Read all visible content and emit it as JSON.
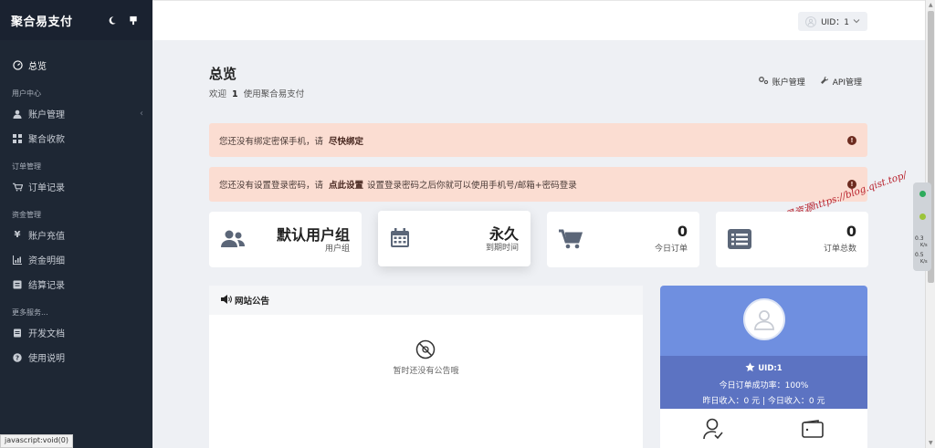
{
  "sidebar": {
    "brand": "聚合易支付",
    "items": [
      {
        "type": "item",
        "label": "总览",
        "icon": "dashboard-icon",
        "active": true
      },
      {
        "type": "header",
        "label": "用户中心"
      },
      {
        "type": "item",
        "label": "账户管理",
        "icon": "user-icon",
        "chevron": true
      },
      {
        "type": "item",
        "label": "聚合收款",
        "icon": "grid-icon"
      },
      {
        "type": "header",
        "label": "订单管理"
      },
      {
        "type": "item",
        "label": "订单记录",
        "icon": "cart-icon"
      },
      {
        "type": "header",
        "label": "资金管理"
      },
      {
        "type": "item",
        "label": "账户充值",
        "icon": "yen-icon"
      },
      {
        "type": "item",
        "label": "资金明细",
        "icon": "chart-icon"
      },
      {
        "type": "item",
        "label": "结算记录",
        "icon": "settle-icon"
      },
      {
        "type": "header",
        "label": "更多服务..."
      },
      {
        "type": "item",
        "label": "开发文档",
        "icon": "doc-icon"
      },
      {
        "type": "item",
        "label": "使用说明",
        "icon": "help-icon"
      }
    ]
  },
  "statusbar": "javascript:void(0)",
  "topbar": {
    "uid_label": "UID：1"
  },
  "page": {
    "title": "总览",
    "welcome_prefix": "欢迎",
    "welcome_uid": "1",
    "welcome_suffix": "使用聚合易支付",
    "account_manage": "账户管理",
    "api_manage": "API管理"
  },
  "alerts": [
    {
      "text": "您还没有绑定密保手机，请",
      "link": "尽快绑定",
      "more": ""
    },
    {
      "text": "您还没有设置登录密码，请",
      "link": "点此设置",
      "more": "设置登录密码之后你就可以使用手机号/邮箱+密码登录"
    }
  ],
  "watermark": "泰星资源https://blog.qist.top/",
  "stats": [
    {
      "value": "默认用户组",
      "label": "用户组",
      "icon": "users-icon"
    },
    {
      "value": "永久",
      "label": "到期时间",
      "icon": "calendar-icon"
    },
    {
      "value": "0",
      "label": "今日订单",
      "icon": "cart-icon"
    },
    {
      "value": "0",
      "label": "订单总数",
      "icon": "list-icon"
    }
  ],
  "notice": {
    "title": "网站公告",
    "empty": "暂时还没有公告哦"
  },
  "profile": {
    "uid": "UID:1",
    "success_rate": "今日订单成功率：100%",
    "income": "昨日收入：0 元 | 今日收入：0 元"
  },
  "float_widget": {
    "v1": "0.3",
    "v2": "0.5",
    "unit": "K/s"
  },
  "colors": {
    "sidebar_bg": "#1e2734",
    "alert_bg": "#fbddd2",
    "profile_top": "#6f8fe0",
    "profile_mid": "#5c73c2",
    "watermark": "#b8202b"
  }
}
